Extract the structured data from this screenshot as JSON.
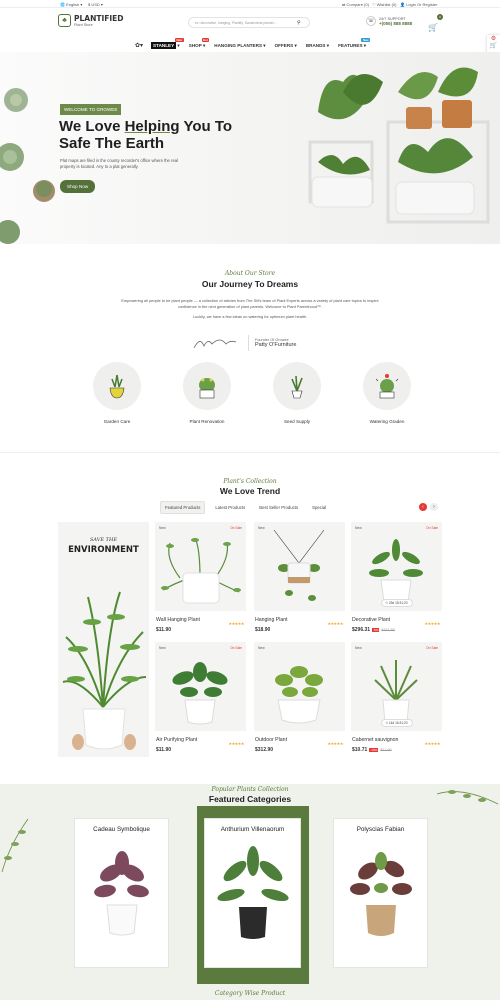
{
  "topbar": {
    "language": "English",
    "currency": "USD",
    "compare": "Compare (0)",
    "wishlist": "Wishlist (0)",
    "account": "Login Or Register"
  },
  "header": {
    "logo_title": "PLANTIFIED",
    "logo_sub": "Plant Store",
    "search_placeholder": "ex: decorative, hanging, Plantify, Sansevieria planter...",
    "support_label": "24/7 SUPPORT",
    "support_phone": "+(055) 888 8888",
    "cart_count": "0"
  },
  "nav": {
    "items": [
      {
        "label": "STANLEY",
        "badge": "New"
      },
      {
        "label": "SHOP",
        "badge": "Hot"
      },
      {
        "label": "HANGING PLANTERS",
        "badge": ""
      },
      {
        "label": "OFFERS",
        "badge": ""
      },
      {
        "label": "BRANDS",
        "badge": ""
      },
      {
        "label": "FEATURES",
        "badge": "New"
      }
    ]
  },
  "hero": {
    "kicker": "WELCOME TO GROWEE",
    "title_pre": "We Love ",
    "title_hl": "Helping",
    "title_post": " You To",
    "title_line2": "Safe The Earth",
    "desc": "Plat maps are filed in the county recorder's office where the real property is located. Any to a plat generally.",
    "cta": "Shop Now"
  },
  "about": {
    "script": "About Our Store",
    "title": "Our Journey To Dreams",
    "p1": "Empowering all people to be plant people — a collection of articles from The Sill's team of Plant Experts across a variety of plant care topics to inspire confidence in the next generation of plant parents. Welcome to Plant Parenthood™.",
    "p2": "Luckily, we have a few ideas on watering for optimum plant health.",
    "founder_label": "Founder Of Growee",
    "founder_name": "Patty O'Furniture",
    "services": [
      "Garden Care",
      "Plant Renovation",
      "Seed Supply",
      "Watering Graden"
    ]
  },
  "trend": {
    "script": "Plant's Collection",
    "title": "We Love Trend",
    "tabs": [
      "Featured Products",
      "Latest Products",
      "Best Seller Products",
      "Special"
    ],
    "banner_small": "SAVE THE",
    "banner_big": "ENVIRONMENT",
    "products": [
      {
        "tag": "New",
        "sale": "On Sale",
        "name": "Wall Hanging Plant",
        "price": "$11.90",
        "old": "",
        "disc": "",
        "timer": ""
      },
      {
        "tag": "New",
        "sale": "",
        "name": "Hanging Plant",
        "price": "$18.90",
        "old": "",
        "disc": "",
        "timer": ""
      },
      {
        "tag": "New",
        "sale": "On Sale",
        "name": "Decorative Plant",
        "price": "$296.31",
        "old": "$311.80",
        "disc": "-5%",
        "timer": "29d 15:31:20"
      },
      {
        "tag": "New",
        "sale": "On Sale",
        "name": "Air Purifying Plant",
        "price": "$11.90",
        "old": "",
        "disc": "",
        "timer": ""
      },
      {
        "tag": "New",
        "sale": "",
        "name": "Outdoor Plant",
        "price": "$312.90",
        "old": "",
        "disc": "",
        "timer": ""
      },
      {
        "tag": "New",
        "sale": "On Sale",
        "name": "Cabernet sauvignon",
        "price": "$10.71",
        "old": "$11.90",
        "disc": "-10%",
        "timer": "14d 16:31:20"
      }
    ]
  },
  "categories": {
    "script": "Popular Plants Collection",
    "title": "Featured Categories",
    "items": [
      "Cadeau Symbolique",
      "Anthurium Villenaorum",
      "Polyscias Fabian"
    ]
  },
  "next_section": {
    "script": "Category Wise Product"
  },
  "colors": {
    "accent": "#55713a",
    "sale": "#e53935",
    "star": "#f5a623"
  }
}
